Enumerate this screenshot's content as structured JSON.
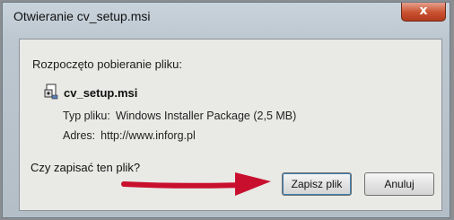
{
  "window": {
    "title": "Otwieranie cv_setup.msi",
    "close_symbol": "x"
  },
  "dialog": {
    "message": "Rozpoczęto pobieranie pliku:",
    "file_name": "cv_setup.msi",
    "file_type_label": "Typ pliku:",
    "file_type_value": "Windows Installer Package (2,5 MB)",
    "address_label": "Adres:",
    "address_value": "http://www.inforg.pl",
    "question": "Czy zapisać ten plik?"
  },
  "buttons": {
    "save": "Zapisz plik",
    "cancel": "Anuluj"
  },
  "colors": {
    "arrow": "#c8102e"
  }
}
